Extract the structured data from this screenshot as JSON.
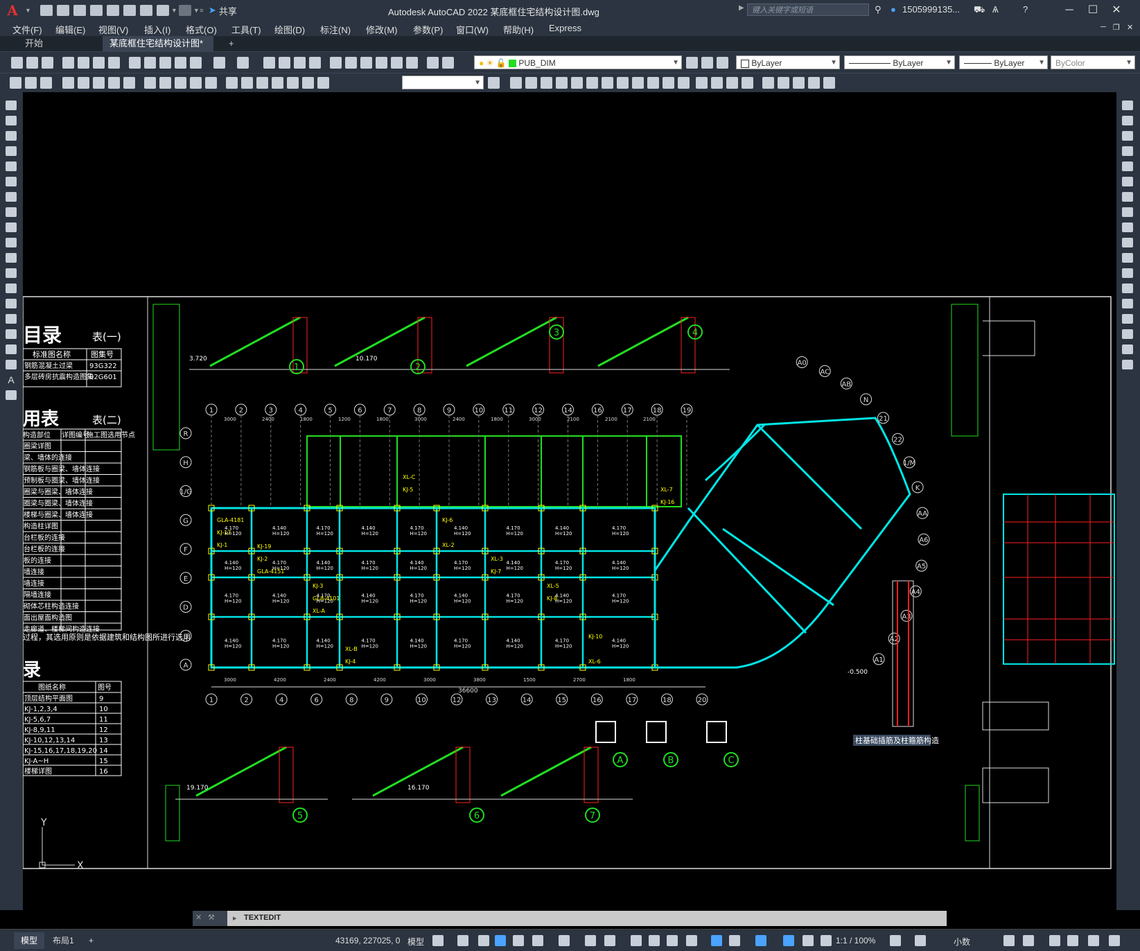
{
  "app": {
    "title": "Autodesk AutoCAD 2022    某底框住宅结构设计图.dwg",
    "logo": "A",
    "share_label": "共享",
    "search_placeholder": "键入关键字或短语",
    "user": "1505999135...",
    "help": "?"
  },
  "menu": [
    "文件(F)",
    "编辑(E)",
    "视图(V)",
    "插入(I)",
    "格式(O)",
    "工具(T)",
    "绘图(D)",
    "标注(N)",
    "修改(M)",
    "参数(P)",
    "窗口(W)",
    "帮助(H)",
    "Express"
  ],
  "tabs": [
    {
      "label": "开始",
      "active": false
    },
    {
      "label": "某底框住宅结构设计图*",
      "active": true
    }
  ],
  "toolbar": {
    "layer": "PUB_DIM",
    "color": "ByLayer",
    "linetype": "ByLayer",
    "lineweight": "ByLayer",
    "plotstyle": "ByColor",
    "textstyle": ""
  },
  "drawing": {
    "table1_title": "目录",
    "table1_sub": "表(一)",
    "table1_headers": [
      "标准图名称",
      "图集号"
    ],
    "table1_rows": [
      [
        "钢筋混凝土过梁",
        "93G322"
      ],
      [
        "多层砖房抗震构造图集",
        "02G601"
      ]
    ],
    "table2_title": "用表",
    "table2_sub": "表(二)",
    "table2_headers": [
      "构造部位",
      "详图编号",
      "施工图选用节点"
    ],
    "table2_rows": [
      "圈梁详图",
      "梁、墙体的连接",
      "钢筋板与圈梁、墙体连接",
      "预制板与圈梁、墙体连接",
      "圈梁与圈梁、墙体连接",
      "圈梁与圈梁、墙体连接",
      "楼梯与圈梁、墙体连接",
      "构造柱详图",
      "台栏板的连接",
      "台栏板的连接",
      "板的连接",
      "墙连接",
      "墙连接",
      "隔墙连接",
      "砌体芯柱构造连接",
      "面出屋面构造图",
      "走廊道、楼梯间构造连接"
    ],
    "note": "过程，其选用原则是依据建筑和结构图所进行选用",
    "table3_title": "录",
    "table3_headers": [
      "图纸名称",
      "图号"
    ],
    "table3_rows": [
      [
        "顶层结构平面图",
        "9"
      ],
      [
        "KJ-1,2,3,4",
        "10"
      ],
      [
        "KJ-5,6,7",
        "11"
      ],
      [
        "KJ-8,9,11",
        "12"
      ],
      [
        "KJ-10,12,13,14",
        "13"
      ],
      [
        "KJ-15,16,17,18,19,20",
        "14"
      ],
      [
        "KJ-A~H",
        "15"
      ],
      [
        "楼梯详图",
        "16"
      ]
    ],
    "axis_top": [
      "1",
      "2",
      "3",
      "4",
      "5",
      "6",
      "7",
      "8",
      "9",
      "10",
      "11",
      "12",
      "14",
      "16",
      "17",
      "18",
      "19"
    ],
    "axis_bottom": [
      "1",
      "2",
      "4",
      "6",
      "8",
      "9",
      "10",
      "12",
      "13",
      "14",
      "15",
      "16",
      "17",
      "18",
      "20"
    ],
    "axis_left": [
      "R",
      "H",
      "1/G",
      "G",
      "F",
      "E",
      "D",
      "B",
      "A"
    ],
    "axis_right_arc": [
      "A0",
      "AC",
      "AB",
      "N",
      "21",
      "22",
      "1/M",
      "K",
      "AA",
      "A6",
      "A5",
      "A4",
      "A3",
      "A2",
      "A1"
    ],
    "dim_total": "36600",
    "dim_top": [
      "3000",
      "2400",
      "1800",
      "1200",
      "1800",
      "3000",
      "2400",
      "1800",
      "3000",
      "2100",
      "2100",
      "2100"
    ],
    "dim_bottom": [
      "3000",
      "4200",
      "2400",
      "4200",
      "3000",
      "3800",
      "1500",
      "2700",
      "1800"
    ],
    "beams": [
      "KJ-1",
      "KJ-2",
      "KJ-3",
      "KJ-4",
      "KJ-5",
      "KJ-6",
      "KJ-7",
      "KJ-8",
      "KJ-10",
      "KJ-16",
      "KJ-17",
      "KJ-19",
      "XL-A",
      "XL-B",
      "XL-C",
      "XL-2",
      "XL-3",
      "XL-5",
      "XL-6",
      "XL-7",
      "GLA-4181",
      "GLA-4151",
      "GLA-4101"
    ],
    "slab_labels": [
      "4.170\nH=120",
      "4.140\nH=120",
      "3.570\nH=100"
    ],
    "detail_labels": [
      "1",
      "2",
      "3",
      "4",
      "5",
      "6",
      "7",
      "A",
      "B",
      "C"
    ],
    "elev_labels": [
      "3.720",
      "10.170",
      "16.170",
      "19.170",
      "-0.500",
      "4.170",
      "4.140"
    ],
    "rebar_note": "柱基础插筋及柱箍筋构造",
    "ucs_y": "Y",
    "ucs_x": "X"
  },
  "command": {
    "text": "TEXTEDIT"
  },
  "status": {
    "coords": "43169, 227025, 0",
    "space": "模型",
    "scale": "1:1 / 100%",
    "units": "小数",
    "layouts": [
      {
        "label": "模型",
        "active": true
      },
      {
        "label": "布局1",
        "active": false
      }
    ],
    "add_layout": "+"
  },
  "colors": {
    "bg": "#000000",
    "chrome": "#2b3440",
    "beam": "#00e5e5",
    "wall": "#ffffff",
    "green": "#22dd22",
    "yellow": "#ffff00",
    "red": "#ff2020"
  }
}
